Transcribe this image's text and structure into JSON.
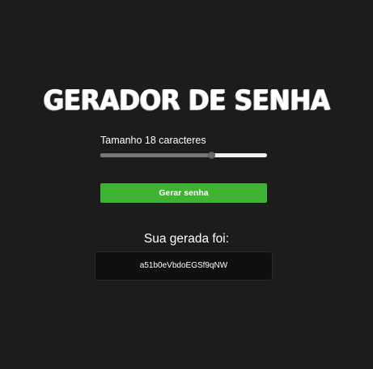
{
  "header": {
    "title": "GERADOR DE SENHA"
  },
  "length_control": {
    "label": "Tamanho 18 caracteres",
    "value": 18,
    "min": 6,
    "max": 24
  },
  "generate_button": {
    "label": "Gerar senha"
  },
  "result": {
    "title": "Sua gerada foi:",
    "password": "a51b0eVbdoEGSf9qNW"
  },
  "colors": {
    "background": "#1c1c1c",
    "button": "#3fb331",
    "result_box": "#0f0f11"
  }
}
